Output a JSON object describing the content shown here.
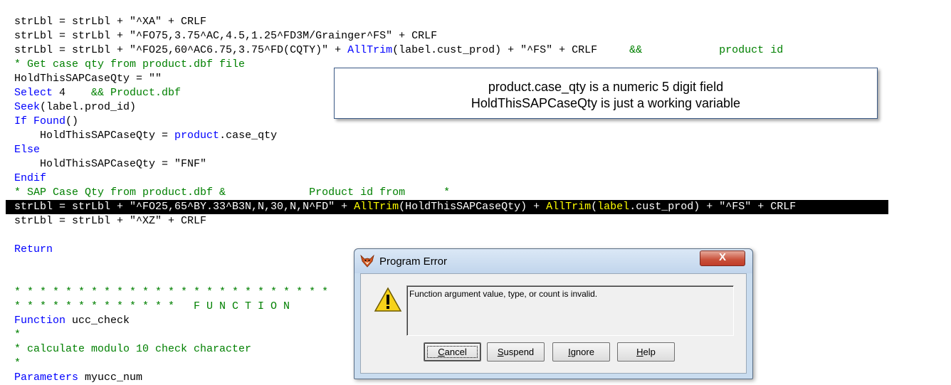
{
  "editor": {
    "lines": [
      {
        "parts": [
          [
            "",
            "strLbl = strLbl + \"^XA\" + CRLF"
          ]
        ]
      },
      {
        "parts": [
          [
            "",
            "strLbl = strLbl + \"^FO75,3.75^AC,4.5,1.25^FD3M/Grainger^FS\" + CRLF"
          ]
        ]
      },
      {
        "parts": [
          [
            "",
            "strLbl = strLbl + \"^FO25,60^AC6.75,3.75^FD(CQTY)\" + "
          ],
          [
            "kw",
            "AllTrim"
          ],
          [
            "",
            "(label.cust_prod) + \"^FS\" + CRLF     "
          ],
          [
            "cm",
            "&&            product id"
          ]
        ]
      },
      {
        "parts": [
          [
            "cm",
            "* Get case qty from product.dbf file"
          ]
        ]
      },
      {
        "parts": [
          [
            "",
            "HoldThisSAPCaseQty = \"\""
          ]
        ]
      },
      {
        "parts": [
          [
            "kw",
            "Select"
          ],
          [
            "",
            " 4    "
          ],
          [
            "cm",
            "&& Product.dbf"
          ]
        ]
      },
      {
        "parts": [
          [
            "kw",
            "Seek"
          ],
          [
            "",
            "(label.prod_id)"
          ]
        ]
      },
      {
        "parts": [
          [
            "kw",
            "If Found"
          ],
          [
            "",
            "()"
          ]
        ]
      },
      {
        "parts": [
          [
            "",
            "    HoldThisSAPCaseQty = "
          ],
          [
            "kw",
            "product"
          ],
          [
            "",
            ".case_qty"
          ]
        ]
      },
      {
        "parts": [
          [
            "kw",
            "Else"
          ]
        ]
      },
      {
        "parts": [
          [
            "",
            "    HoldThisSAPCaseQty = \"FNF\""
          ]
        ]
      },
      {
        "parts": [
          [
            "kw",
            "Endif"
          ]
        ]
      },
      {
        "parts": [
          [
            "cm",
            "* SAP Case Qty from product.dbf &             Product id from      *"
          ]
        ]
      },
      {
        "selected": true,
        "parts": [
          [
            "sel-str",
            "strLbl = strLbl + \"^FO25,65^BY.33^B3N,N,30,N,N^FD\" + "
          ],
          [
            "sel-fn",
            "AllTrim"
          ],
          [
            "sel-str",
            "(HoldThisSAPCaseQty) + "
          ],
          [
            "sel-fn",
            "AllTrim"
          ],
          [
            "sel-str",
            "("
          ],
          [
            "sel-fn",
            "label"
          ],
          [
            "sel-str",
            ".cust_prod) + \"^FS\" + CRLF"
          ]
        ]
      },
      {
        "parts": [
          [
            "",
            "strLbl = strLbl + \"^XZ\" + CRLF"
          ]
        ]
      },
      {
        "parts": [
          [
            "",
            ""
          ]
        ]
      },
      {
        "parts": [
          [
            "kw",
            "Return"
          ]
        ]
      },
      {
        "parts": [
          [
            "",
            ""
          ]
        ]
      },
      {
        "parts": [
          [
            "",
            ""
          ]
        ]
      },
      {
        "parts": [
          [
            "cm",
            "* * * * * * * * * * * * * * * * * * * * * * * * *"
          ]
        ]
      },
      {
        "parts": [
          [
            "cm",
            "* * * * * * * * * * * * *   F U N C T I O N"
          ]
        ]
      },
      {
        "parts": [
          [
            "kw",
            "Function"
          ],
          [
            "",
            " ucc_check"
          ]
        ]
      },
      {
        "parts": [
          [
            "cm",
            "*"
          ]
        ]
      },
      {
        "parts": [
          [
            "cm",
            "* calculate modulo 10 check character"
          ]
        ]
      },
      {
        "parts": [
          [
            "cm",
            "*"
          ]
        ]
      },
      {
        "parts": [
          [
            "kw",
            "Parameters"
          ],
          [
            "",
            " myucc_num"
          ]
        ]
      }
    ],
    "top_fragment": "_______"
  },
  "callout": {
    "line1": "product.case_qty is a numeric 5 digit field",
    "line2": "HoldThisSAPCaseQty is just a working variable"
  },
  "dialog": {
    "title": "Program Error",
    "close_label": "X",
    "message": "Function argument value, type, or count is invalid.",
    "buttons": {
      "cancel": {
        "u": "C",
        "rest": "ancel"
      },
      "suspend": {
        "u": "S",
        "rest": "uspend"
      },
      "ignore": {
        "u": "I",
        "rest": "gnore"
      },
      "help": {
        "u": "H",
        "rest": "elp"
      }
    },
    "icons": {
      "app": "fox-icon",
      "warning": "warning-icon"
    }
  }
}
